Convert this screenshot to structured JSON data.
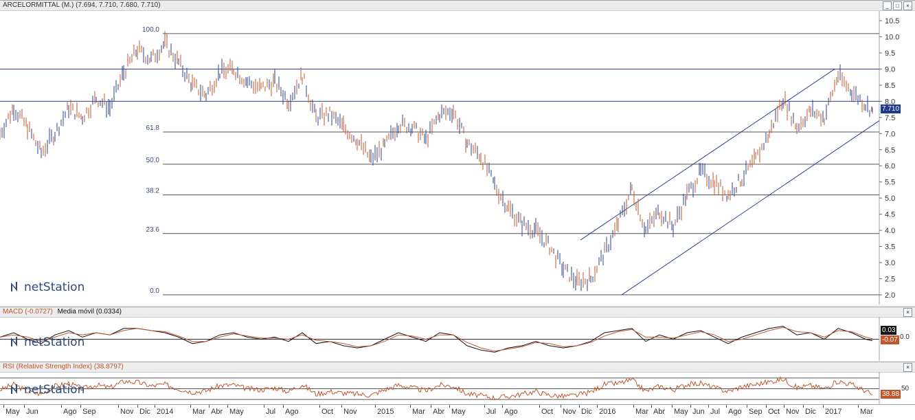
{
  "main_panel": {
    "header": "ARCELORMITTAL (M.) (7.694, 7.710, 7.680, 7.710)",
    "last_price": "7.710",
    "logo": "netStation"
  },
  "macd_panel": {
    "header_name": "MACD (-0.0727)",
    "header_signal": "Media móvil (0.0334)",
    "tag_signal": "0.03",
    "tag_macd": "-0.07",
    "axis_label": "0.0",
    "logo": "netStation"
  },
  "rsi_panel": {
    "header": "RSI (Relative Strength Index) (38.8797)",
    "tag_value": "38.88",
    "axis_label": "50",
    "logo": "netStation"
  },
  "colors": {
    "up": "#2b3f8f",
    "down": "#c0562b",
    "macd": "#111111",
    "signal": "#c0562b",
    "rsi": "#c0562b",
    "line": "#2b3f8f"
  },
  "window_buttons": [
    "minimize-icon",
    "maximize-icon",
    "close-icon"
  ],
  "chart_data": {
    "type": "line",
    "title": "ARCELORMITTAL (M.)",
    "price_axis": {
      "ylim": [
        1.7,
        10.8
      ],
      "ticks": [
        "10.5",
        "10.0",
        "9.5",
        "9.0",
        "8.5",
        "8.0",
        "7.5",
        "7.0",
        "6.5",
        "6.0",
        "5.5",
        "5.0",
        "4.5",
        "4.0",
        "3.5",
        "3.0",
        "2.5",
        "2.0"
      ]
    },
    "x_labels": [
      "May",
      "Jun",
      "Ago",
      "Sep",
      "Nov",
      "Dic",
      "2014",
      "Mar",
      "Abr",
      "May",
      "Jul",
      "Ago",
      "Oct",
      "Nov",
      "2015",
      "Mar",
      "Abr",
      "May",
      "Jul",
      "Ago",
      "Oct",
      "Nov",
      "Dic",
      "2016",
      "Mar",
      "Abr",
      "May",
      "Jun",
      "Jul",
      "Ago",
      "Sep",
      "Oct",
      "Nov",
      "Dic",
      "2017",
      "Mar"
    ],
    "price_series": {
      "name": "ARCELORMITTAL",
      "x": [
        0,
        20,
        40,
        60,
        80,
        100,
        120,
        140,
        160,
        180,
        200,
        220,
        240,
        260,
        280,
        300,
        320,
        340,
        360,
        380,
        400,
        420,
        440,
        460,
        480,
        500,
        520,
        540,
        560,
        580,
        600,
        620,
        640,
        660,
        680,
        700,
        720,
        740,
        760,
        780,
        800,
        820,
        840,
        860,
        880,
        900,
        920,
        940,
        960,
        980,
        1000,
        1020,
        1040,
        1060,
        1080,
        1100,
        1120,
        1140,
        1160,
        1180,
        1200,
        1220,
        1240,
        1260,
        1270
      ],
      "values": [
        7.0,
        7.8,
        7.2,
        6.4,
        7.0,
        7.8,
        7.5,
        8.1,
        7.8,
        8.9,
        9.6,
        9.3,
        9.8,
        9.2,
        8.5,
        8.2,
        8.9,
        9.0,
        8.6,
        8.4,
        8.6,
        8.0,
        8.8,
        7.5,
        7.6,
        7.2,
        6.8,
        6.2,
        6.6,
        7.3,
        7.2,
        6.8,
        7.6,
        7.7,
        6.7,
        6.3,
        5.4,
        4.7,
        4.2,
        4.0,
        3.5,
        2.8,
        2.4,
        2.5,
        3.3,
        4.2,
        5.3,
        4.0,
        4.6,
        4.1,
        5.1,
        5.8,
        5.5,
        5.1,
        5.6,
        6.2,
        7.0,
        8.1,
        7.2,
        7.7,
        7.5,
        8.8,
        8.3,
        7.9,
        7.71
      ]
    },
    "fibonacci_levels": [
      {
        "label": "100.0",
        "price": 10.1
      },
      {
        "label": "61.8",
        "price": 7.05
      },
      {
        "label": "50.0",
        "price": 6.05
      },
      {
        "label": "38.2",
        "price": 5.1
      },
      {
        "label": "23.6",
        "price": 3.9
      },
      {
        "label": "0.0",
        "price": 2.0
      }
    ],
    "horizontal_lines": [
      9.0,
      8.0
    ],
    "channel": {
      "upper": [
        [
          845,
          3.7
        ],
        [
          1215,
          9.0
        ]
      ],
      "lower": [
        [
          905,
          2.0
        ],
        [
          1280,
          7.4
        ]
      ]
    },
    "macd": {
      "series": [
        {
          "name": "MACD",
          "values": [
            0.1,
            0.3,
            0.0,
            -0.2,
            0.2,
            0.4,
            0.1,
            0.3,
            0.2,
            0.5,
            0.5,
            0.4,
            0.3,
            0.1,
            -0.2,
            -0.1,
            0.2,
            0.3,
            0.1,
            0.0,
            0.1,
            -0.1,
            0.3,
            -0.2,
            -0.1,
            -0.3,
            -0.4,
            -0.3,
            0.0,
            0.3,
            0.1,
            -0.1,
            0.3,
            0.2,
            -0.3,
            -0.5,
            -0.6,
            -0.4,
            -0.3,
            -0.1,
            -0.3,
            -0.4,
            -0.3,
            -0.1,
            0.3,
            0.4,
            0.5,
            -0.1,
            0.2,
            0.0,
            0.3,
            0.4,
            0.1,
            -0.2,
            0.1,
            0.3,
            0.5,
            0.6,
            0.2,
            0.3,
            0.0,
            0.5,
            0.3,
            0.0,
            -0.07
          ]
        },
        {
          "name": "Media móvil",
          "values": [
            0.1,
            0.2,
            0.1,
            -0.1,
            0.1,
            0.3,
            0.2,
            0.3,
            0.2,
            0.4,
            0.5,
            0.4,
            0.35,
            0.15,
            -0.1,
            -0.1,
            0.1,
            0.25,
            0.15,
            0.05,
            0.05,
            0.0,
            0.2,
            -0.05,
            -0.1,
            -0.2,
            -0.35,
            -0.3,
            -0.1,
            0.2,
            0.15,
            0.0,
            0.2,
            0.2,
            -0.15,
            -0.4,
            -0.55,
            -0.45,
            -0.35,
            -0.15,
            -0.2,
            -0.35,
            -0.3,
            -0.15,
            0.15,
            0.35,
            0.45,
            0.1,
            0.1,
            0.05,
            0.2,
            0.35,
            0.2,
            -0.1,
            0.0,
            0.2,
            0.4,
            0.55,
            0.35,
            0.3,
            0.1,
            0.4,
            0.35,
            0.1,
            0.03
          ]
        }
      ],
      "ylim": [
        -1.0,
        1.0
      ]
    },
    "rsi": {
      "series": [
        {
          "name": "RSI",
          "values": [
            48,
            58,
            45,
            40,
            55,
            60,
            50,
            57,
            52,
            64,
            62,
            55,
            58,
            50,
            44,
            46,
            56,
            57,
            50,
            48,
            52,
            45,
            58,
            40,
            45,
            42,
            40,
            38,
            48,
            57,
            52,
            46,
            57,
            55,
            40,
            37,
            33,
            36,
            40,
            45,
            38,
            36,
            38,
            44,
            58,
            60,
            66,
            45,
            55,
            48,
            58,
            60,
            52,
            45,
            54,
            58,
            63,
            68,
            52,
            56,
            50,
            64,
            58,
            46,
            38.88
          ]
        }
      ],
      "ylim": [
        20,
        80
      ],
      "guide_lines": [
        70,
        50,
        30
      ]
    }
  }
}
